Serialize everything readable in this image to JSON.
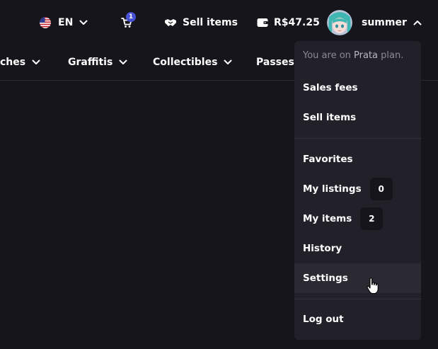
{
  "header": {
    "language": {
      "label": "EN",
      "flag_icon": "us-flag-icon"
    },
    "cart": {
      "count": "1",
      "icon": "cart-icon"
    },
    "sell": {
      "label": "Sell items",
      "icon": "handshake-icon"
    },
    "wallet": {
      "balance": "R$47.25",
      "icon": "wallet-icon"
    },
    "user": {
      "name": "summer",
      "avatar_icon": "avatar"
    }
  },
  "categories": [
    {
      "label": "ches"
    },
    {
      "label": "Graffitis"
    },
    {
      "label": "Collectibles"
    },
    {
      "label": "Passes"
    }
  ],
  "user_menu": {
    "plan_prefix": "You are on ",
    "plan_name": "Prata",
    "plan_suffix": " plan.",
    "items": [
      {
        "label": "Sales fees"
      },
      {
        "label": "Sell items"
      },
      {
        "label": "Favorites"
      },
      {
        "label": "My listings",
        "badge": "0"
      },
      {
        "label": "My items",
        "badge": "2"
      },
      {
        "label": "History"
      },
      {
        "label": "Settings"
      },
      {
        "label": "Log out"
      }
    ]
  },
  "colors": {
    "background": "#16151b",
    "menu_background": "#22212a",
    "cart_badge": "#4651d6",
    "muted_text": "#8b8a93"
  }
}
